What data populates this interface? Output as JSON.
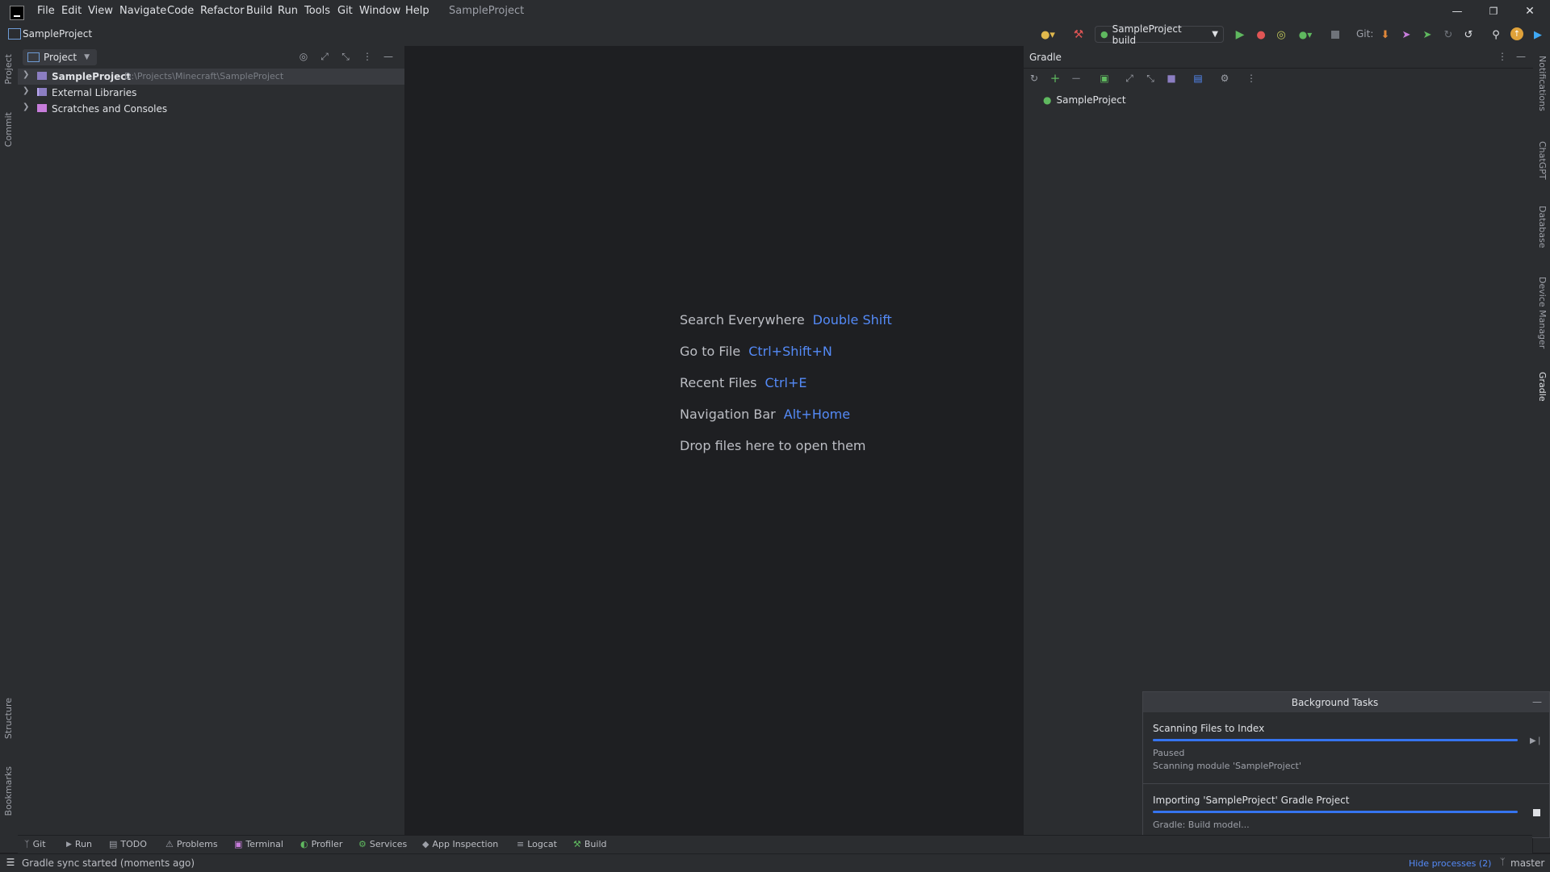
{
  "titlebar": {
    "menu": [
      "File",
      "Edit",
      "View",
      "Navigate",
      "Code",
      "Refactor",
      "Build",
      "Run",
      "Tools",
      "Git",
      "Window",
      "Help"
    ],
    "project_title": "SampleProject"
  },
  "navbar": {
    "breadcrumb": "SampleProject",
    "run_config": "SampleProject build",
    "git_label": "Git:"
  },
  "left_stripe": {
    "top": [
      "Project",
      "Commit"
    ],
    "bottom": [
      "Structure",
      "Bookmarks"
    ]
  },
  "right_stripe": [
    "Notifications",
    "ChatGPT",
    "Database",
    "Device Manager",
    "Gradle"
  ],
  "project_panel": {
    "header": "Project",
    "tree": [
      {
        "label": "SampleProject",
        "path": "D:\\Projects\\Minecraft\\SampleProject"
      },
      {
        "label": "External Libraries",
        "path": ""
      },
      {
        "label": "Scratches and Consoles",
        "path": ""
      }
    ]
  },
  "editor": {
    "hints": [
      {
        "label": "Search Everywhere",
        "key": "Double Shift"
      },
      {
        "label": "Go to File",
        "key": "Ctrl+Shift+N"
      },
      {
        "label": "Recent Files",
        "key": "Ctrl+E"
      },
      {
        "label": "Navigation Bar",
        "key": "Alt+Home"
      },
      {
        "label": "Drop files here to open them",
        "key": ""
      }
    ]
  },
  "gradle_panel": {
    "title": "Gradle",
    "root": "SampleProject"
  },
  "background_tasks": {
    "title": "Background Tasks",
    "tasks": [
      {
        "title": "Scanning Files to Index",
        "status": "Paused",
        "detail": "Scanning module 'SampleProject'",
        "progress": 1.0
      },
      {
        "title": "Importing 'SampleProject' Gradle Project",
        "status": "Gradle: Build model...",
        "detail": "",
        "progress": 1.0
      }
    ]
  },
  "bottom_toolbar": [
    "Git",
    "Run",
    "TODO",
    "Problems",
    "Terminal",
    "Profiler",
    "Services",
    "App Inspection",
    "Logcat",
    "Build"
  ],
  "statusbar": {
    "message": "Gradle sync started (moments ago)",
    "hide_processes": "Hide processes (2)",
    "branch": "master"
  },
  "colors": {
    "accent": "#3574f0",
    "link": "#548af7",
    "background": "#1e1f22",
    "panel": "#2b2d30"
  }
}
